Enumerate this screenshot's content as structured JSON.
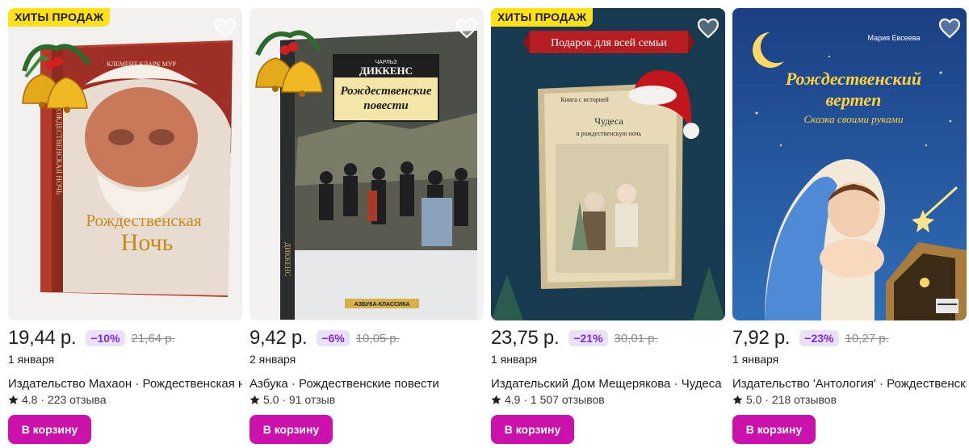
{
  "badge_label": "ХИТЫ ПРОДАЖ",
  "cart_label": "В корзину",
  "products": [
    {
      "hit": true,
      "price": "19,44 р.",
      "discount": "−10%",
      "old_price": "21,64 р.",
      "delivery": "1 января",
      "title": "Издательство Махаон · Рождественская ночь",
      "rating": "4.8",
      "reviews": "· 223 отзыва",
      "cover": {
        "author": "КЛЕМЕНТ КЛАРК МУР",
        "title_line1": "Рождественская",
        "title_line2": "Ночь",
        "spine": "РОЖДЕСТВЕНСКАЯ НОЧЬ"
      }
    },
    {
      "hit": false,
      "price": "9,42 р.",
      "discount": "−6%",
      "old_price": "10,05 р.",
      "delivery": "2 января",
      "title": "Азбука · Рождественские повести",
      "rating": "5.0",
      "reviews": "· 91 отзыв",
      "cover": {
        "author_small": "ЧАРЛЬЗ",
        "author": "ДИККЕНС",
        "title_line1": "Рождественские",
        "title_line2": "повести",
        "series": "АЗБУКА-КЛАССИКА",
        "spine": "ДИККЕНС"
      }
    },
    {
      "hit": true,
      "price": "23,75 р.",
      "discount": "−21%",
      "old_price": "30,01 р.",
      "delivery": "1 января",
      "title": "Издательский Дом Мещерякова · Чудеса в рождественскую ночь",
      "rating": "4.9",
      "reviews": "· 1 507 отзывов",
      "cover": {
        "banner": "Подарок для всей семьи",
        "series": "Книга с историей",
        "title_line1": "Чудеса",
        "title_line2": "в рождественскую ночь"
      }
    },
    {
      "hit": false,
      "price": "7,92 р.",
      "discount": "−23%",
      "old_price": "10,27 р.",
      "delivery": "1 января",
      "title": "Издательство 'Антология' · Рождественский вертеп",
      "rating": "5.0",
      "reviews": "· 218 отзывов",
      "cover": {
        "author": "Мария Евсеева",
        "title_line1": "Рождественский",
        "title_line2": "вертеп",
        "subtitle": "Сказка своими руками"
      }
    }
  ],
  "colors": {
    "accent": "#cb11ab",
    "badge_bg": "#ffe11b",
    "discount_bg": "#ebe0fb",
    "discount_text": "#7a2bd8"
  }
}
